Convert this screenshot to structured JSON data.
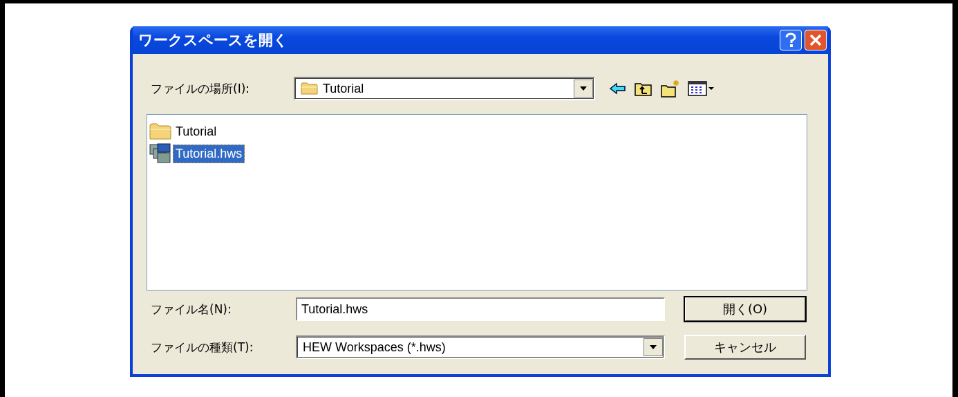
{
  "window": {
    "title": "ワークスペースを開く"
  },
  "location": {
    "label": "ファイルの場所(I):",
    "value": "Tutorial"
  },
  "files": [
    {
      "name": "Tutorial",
      "kind": "folder",
      "selected": false
    },
    {
      "name": "Tutorial.hws",
      "kind": "workspace",
      "selected": true
    }
  ],
  "file_name": {
    "label": "ファイル名(N):",
    "value": "Tutorial.hws"
  },
  "file_type": {
    "label": "ファイルの種類(T):",
    "value": "HEW Workspaces (*.hws)"
  },
  "buttons": [
    {
      "label": "開く(O)",
      "default": true
    },
    {
      "label": "キャンセル",
      "default": false
    }
  ]
}
